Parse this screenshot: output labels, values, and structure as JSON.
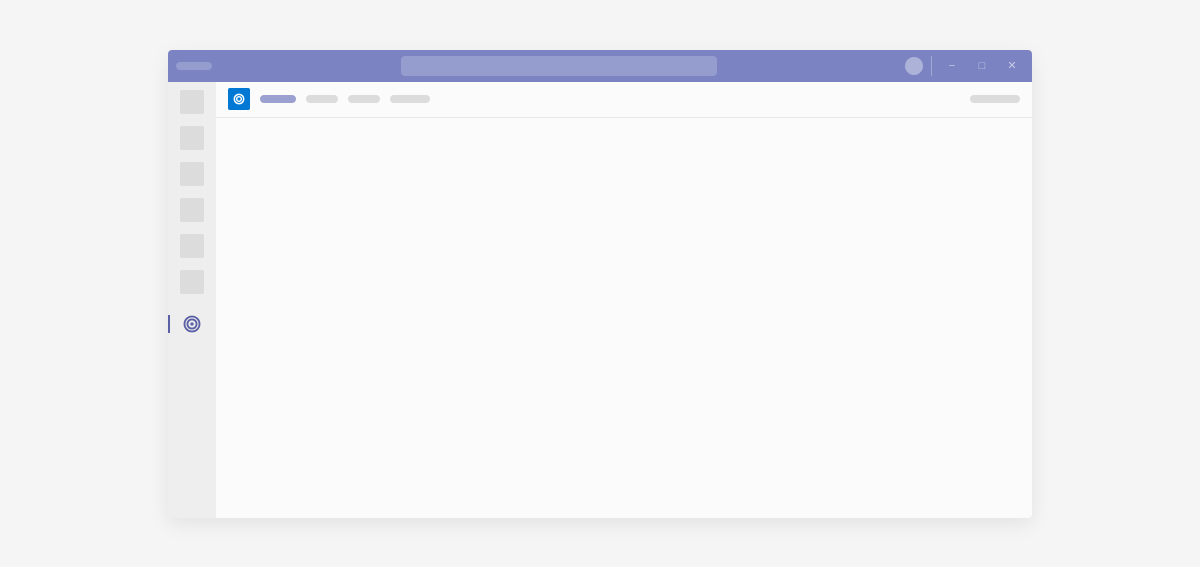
{
  "titlebar": {
    "title_placeholder": "",
    "search_placeholder": ""
  },
  "window_controls": {
    "minimize": "−",
    "maximize": "□",
    "close": "✕"
  },
  "rail": {
    "items": [
      {
        "label": ""
      },
      {
        "label": ""
      },
      {
        "label": ""
      },
      {
        "label": ""
      },
      {
        "label": ""
      },
      {
        "label": ""
      }
    ],
    "active_app": {
      "label": ""
    }
  },
  "tabbar": {
    "app_icon": "swirl-icon",
    "tabs": [
      {
        "label": "",
        "active": true
      },
      {
        "label": "",
        "active": false
      },
      {
        "label": "",
        "active": false
      },
      {
        "label": "",
        "active": false
      }
    ],
    "right_action": ""
  },
  "colors": {
    "brand": "#7b83c2",
    "brand_light": "#959cce",
    "accent_blue": "#0078d4",
    "rail_bg": "#eeeeee",
    "rail_item": "#dcdcdc"
  }
}
